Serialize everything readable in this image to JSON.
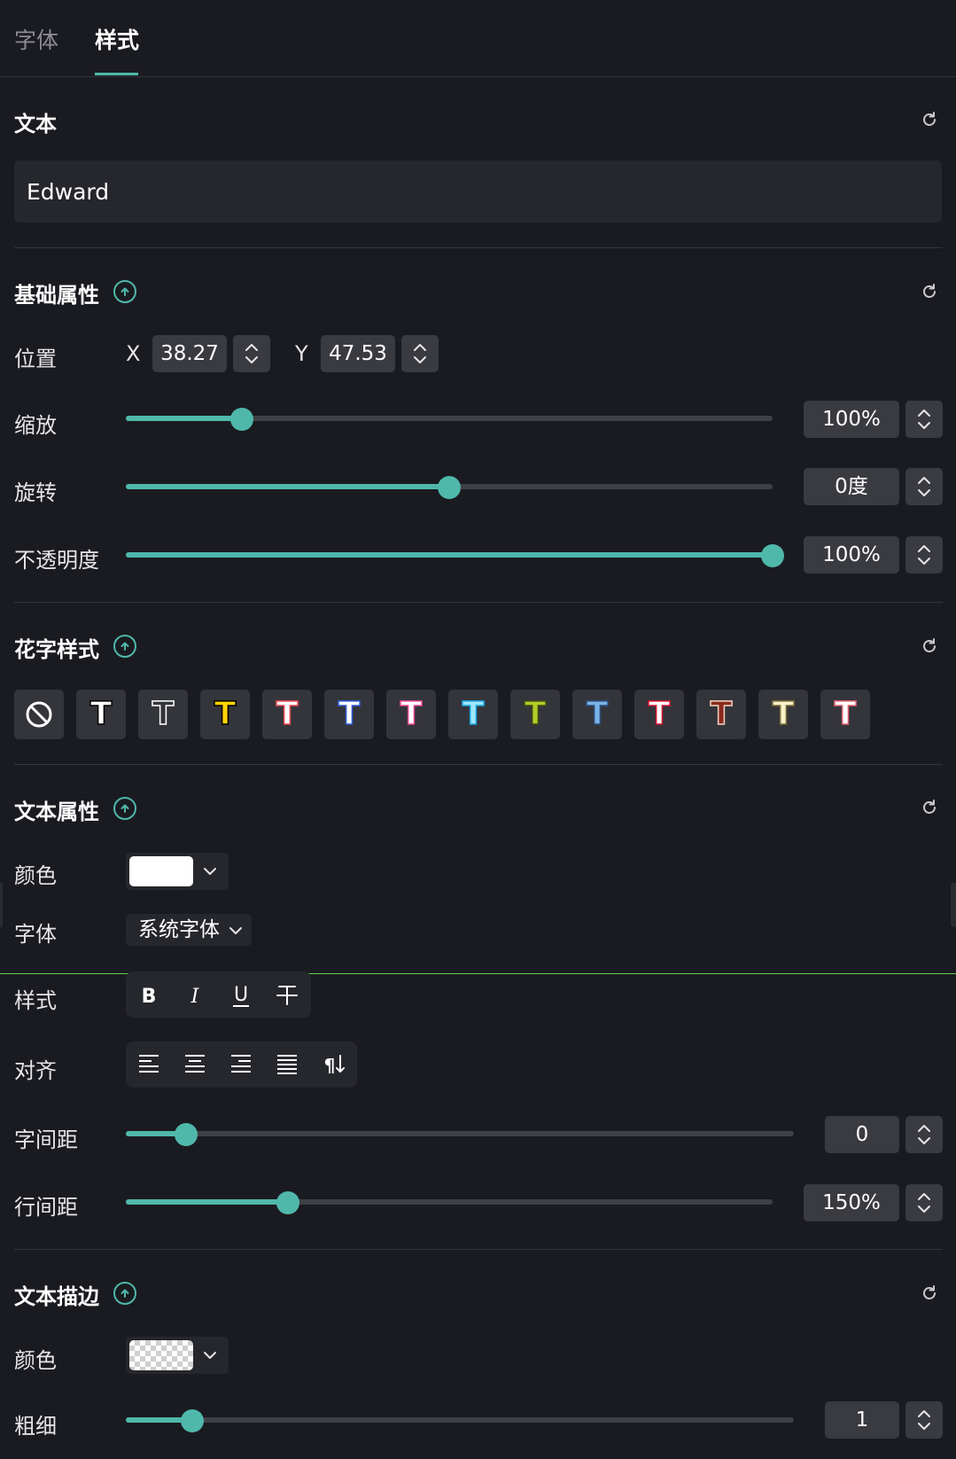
{
  "tabs": [
    {
      "label": "字体",
      "active": false
    },
    {
      "label": "样式",
      "active": true
    }
  ],
  "text_section": {
    "title": "文本",
    "value": "Edward"
  },
  "basic": {
    "title": "基础属性",
    "position_label": "位置",
    "x_label": "X",
    "x_value": "38.27",
    "y_label": "Y",
    "y_value": "47.53",
    "scale_label": "缩放",
    "scale_value": "100%",
    "scale_level": 0.18,
    "rotate_label": "旋转",
    "rotate_value": "0度",
    "rotate_level": 0.5,
    "opacity_label": "不透明度",
    "opacity_value": "100%",
    "opacity_level": 1.0
  },
  "fancy": {
    "title": "花字样式",
    "styles": [
      {
        "glyph": "T",
        "fill": "#ffffff",
        "stroke": "#000000"
      },
      {
        "glyph": "T",
        "fill": "#34353b",
        "stroke": "#ffffff"
      },
      {
        "glyph": "T",
        "fill": "#ffd400",
        "stroke": "#000000"
      },
      {
        "glyph": "T",
        "fill": "#ffffff",
        "stroke": "#e8454a"
      },
      {
        "glyph": "T",
        "fill": "#ffffff",
        "stroke": "#2a5bd8"
      },
      {
        "glyph": "T",
        "fill": "#ffffff",
        "stroke": "#e8458f"
      },
      {
        "glyph": "T",
        "fill": "#9fe7ff",
        "stroke": "#1aa3e0"
      },
      {
        "glyph": "T",
        "fill": "#b4cc2a",
        "stroke": "#3c4a10"
      },
      {
        "glyph": "T",
        "fill": "#7ab3e6",
        "stroke": "#2a4d7a"
      },
      {
        "glyph": "T",
        "fill": "#ffffff",
        "stroke": "#d6102e"
      },
      {
        "glyph": "T",
        "fill": "#8a2a1e",
        "stroke": "#f0d0c0"
      },
      {
        "glyph": "T",
        "fill": "#f7f0c8",
        "stroke": "#7a6a3a"
      },
      {
        "glyph": "T",
        "fill": "#ffffff",
        "stroke": "#e06070"
      }
    ]
  },
  "text_props": {
    "title": "文本属性",
    "color_label": "颜色",
    "color_value": "#ffffff",
    "font_label": "字体",
    "font_value": "系统字体",
    "style_label": "样式",
    "style_buttons": [
      "B",
      "I",
      "U",
      "S"
    ],
    "align_label": "对齐",
    "align_buttons": [
      "left",
      "center",
      "right",
      "justify",
      "vertical"
    ],
    "letter_spacing_label": "字间距",
    "letter_spacing_value": "0",
    "letter_spacing_level": 0.09,
    "line_spacing_label": "行间距",
    "line_spacing_value": "150%",
    "line_spacing_level": 0.25
  },
  "stroke": {
    "title": "文本描边",
    "color_label": "颜色",
    "color_value": "transparent",
    "width_label": "粗细",
    "width_value": "1",
    "width_level": 0.1
  },
  "colors": {
    "accent": "#4fb8ab",
    "background": "#1a1b20",
    "field": "#3a3b41"
  }
}
